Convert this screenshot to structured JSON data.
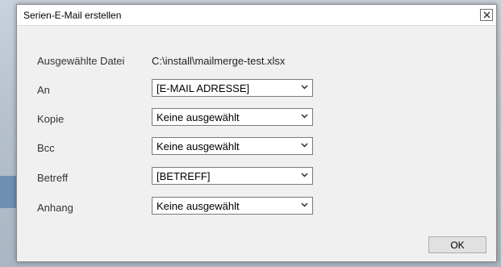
{
  "window": {
    "title": "Serien-E-Mail erstellen",
    "close_icon": "close-icon"
  },
  "form": {
    "file_label": "Ausgewählte Datei",
    "file_value": "C:\\install\\mailmerge-test.xlsx",
    "fields": [
      {
        "label": "An",
        "value": "[E-MAIL ADRESSE]"
      },
      {
        "label": "Kopie",
        "value": "Keine ausgewählt"
      },
      {
        "label": "Bcc",
        "value": "Keine ausgewählt"
      },
      {
        "label": "Betreff",
        "value": "[BETREFF]"
      },
      {
        "label": "Anhang",
        "value": "Keine ausgewählt"
      }
    ]
  },
  "buttons": {
    "ok_label": "OK"
  }
}
